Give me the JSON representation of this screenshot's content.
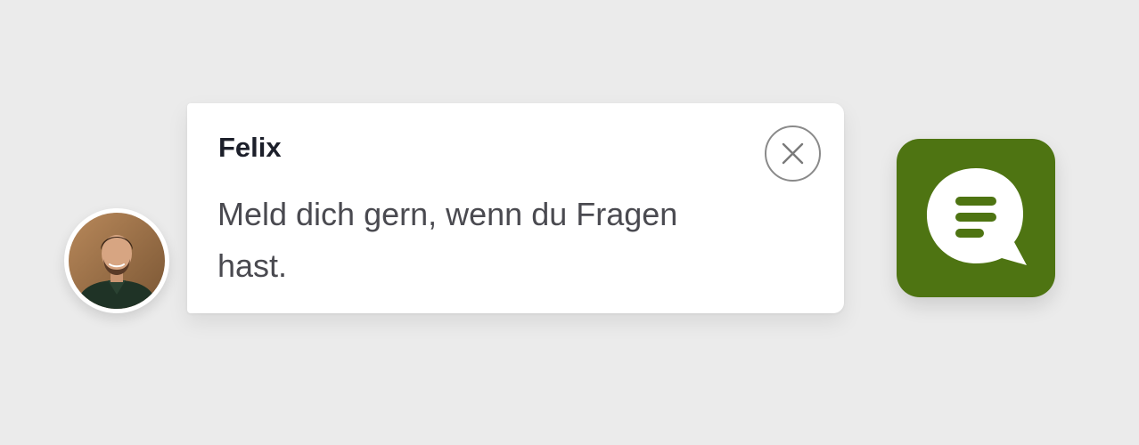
{
  "widget": {
    "sender_name": "Felix",
    "message": "Meld dich gern, wenn du Fragen hast.",
    "close_icon": "close-icon",
    "launcher_icon": "chat-bubble-icon",
    "avatar_icon": "agent-avatar",
    "accent_color": "#4e7412"
  }
}
